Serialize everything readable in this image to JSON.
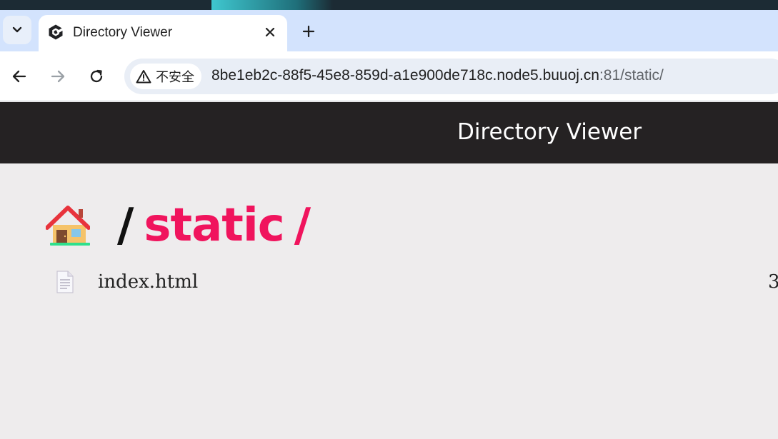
{
  "browser": {
    "tab": {
      "title": "Directory Viewer"
    },
    "security": {
      "label": "不安全"
    },
    "url": {
      "host": "8be1eb2c-88f5-45e8-859d-a1e900de718c.node5.buuoj.cn",
      "path": ":81/static/"
    }
  },
  "page": {
    "header": {
      "title": "Directory Viewer"
    },
    "breadcrumb": {
      "root_separator": "/",
      "current": "static",
      "end_separator": "/"
    },
    "files": [
      {
        "name": "index.html",
        "size": "3"
      }
    ]
  },
  "icons": {
    "tab_menu": "chevron-down-icon",
    "favicon": "site-logo-icon",
    "close": "close-icon",
    "new_tab": "plus-icon",
    "back": "arrow-left-icon",
    "forward": "arrow-right-icon",
    "reload": "reload-icon",
    "warning": "warning-triangle-icon",
    "home": "house-emoji-icon",
    "file": "document-icon"
  },
  "colors": {
    "tabbar_bg": "#d3e3fd",
    "header_bg": "#252223",
    "page_bg": "#eeeced",
    "accent": "#f0145d"
  }
}
